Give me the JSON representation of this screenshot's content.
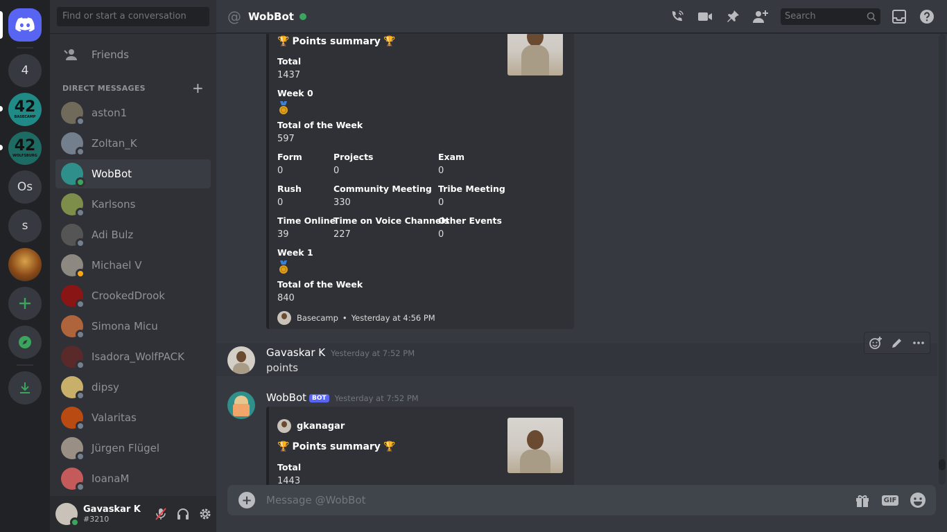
{
  "servers": [
    {
      "name": "discord-home",
      "label": ""
    },
    {
      "name": "server-4",
      "label": "4"
    },
    {
      "name": "server-42-basecamp",
      "label": "42",
      "caption": "BASECAMP"
    },
    {
      "name": "server-42-wolfsburg",
      "label": "42",
      "caption": "WOLFSBURG"
    },
    {
      "name": "server-os",
      "label": "Os"
    },
    {
      "name": "server-s",
      "label": "s"
    }
  ],
  "sidebar": {
    "search_placeholder": "Find or start a conversation",
    "friends_label": "Friends",
    "dm_header": "DIRECT MESSAGES",
    "dms": [
      {
        "name": "aston1",
        "status": "offline",
        "color": "#6f6a5a"
      },
      {
        "name": "Zoltan_K",
        "status": "offline",
        "color": "#747f8d"
      },
      {
        "name": "WobBot",
        "status": "online",
        "color": "#2f8f8a"
      },
      {
        "name": "Karlsons",
        "status": "offline",
        "color": "#7d8d4a"
      },
      {
        "name": "Adi Bulz",
        "status": "offline",
        "color": "#555555"
      },
      {
        "name": "Michael V",
        "status": "idle",
        "color": "#8d8880"
      },
      {
        "name": "CrookedDrook",
        "status": "offline",
        "color": "#8a1515"
      },
      {
        "name": "Simona Micu",
        "status": "offline",
        "color": "#b0643c"
      },
      {
        "name": "Isadora_WolfPACK",
        "status": "offline",
        "color": "#5a2a2a"
      },
      {
        "name": "dipsy",
        "status": "offline",
        "color": "#c9b06a"
      },
      {
        "name": "Valaritas",
        "status": "offline",
        "color": "#b84a12"
      },
      {
        "name": "Jürgen Flügel",
        "status": "offline",
        "color": "#9a8f85"
      },
      {
        "name": "IoanaM",
        "status": "offline",
        "color": "#c55a5a"
      }
    ]
  },
  "user": {
    "name": "Gavaskar K",
    "tag": "#3210"
  },
  "header": {
    "channel": "WobBot",
    "search_placeholder": "Search"
  },
  "embed1": {
    "title": "Points summary",
    "total_label": "Total",
    "total": "1437",
    "week0_label": "Week 0",
    "totalweek_label": "Total of the Week",
    "totalweek": "597",
    "fields": [
      {
        "label": "Form",
        "value": "0"
      },
      {
        "label": "Projects",
        "value": "0"
      },
      {
        "label": "Exam",
        "value": "0"
      },
      {
        "label": "Rush",
        "value": "0"
      },
      {
        "label": "Community Meeting",
        "value": "330"
      },
      {
        "label": "Tribe Meeting",
        "value": "0"
      },
      {
        "label": "Time Online",
        "value": "39"
      },
      {
        "label": "Time on Voice Channels",
        "value": "227"
      },
      {
        "label": "Other Events",
        "value": "0"
      }
    ],
    "week1_label": "Week 1",
    "totalweek2_label": "Total of the Week",
    "totalweek2": "840",
    "footer_source": "Basecamp",
    "footer_sep": "•",
    "footer_time": "Yesterday at 4:56 PM"
  },
  "msg1": {
    "author": "Gavaskar K",
    "time": "Yesterday at 7:52 PM",
    "text": "points"
  },
  "msg2": {
    "author": "WobBot",
    "bot_tag": "BOT",
    "time": "Yesterday at 7:52 PM"
  },
  "embed2": {
    "author": "gkanagar",
    "title": "Points summary",
    "total_label": "Total",
    "total": "1443"
  },
  "composer": {
    "placeholder": "Message @WobBot",
    "gif_label": "GIF"
  },
  "colors": {
    "accent": "#5865f2",
    "online": "#3ba55d",
    "idle": "#faa81a",
    "offline": "#747f8d",
    "green": "#3ba55d"
  }
}
